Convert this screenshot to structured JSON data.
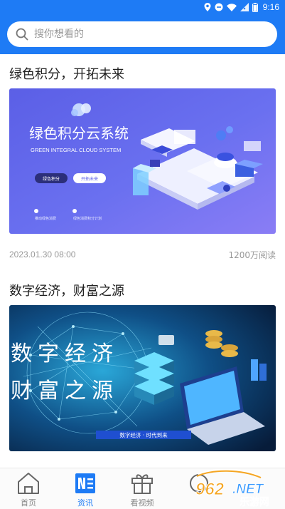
{
  "status_bar": {
    "time": "9:16"
  },
  "search": {
    "placeholder": "搜你想看的"
  },
  "articles": [
    {
      "title": "绿色积分，开拓未来",
      "banner": {
        "heading": "绿色积分云系统",
        "subheading": "GREEN INTEGRAL CLOUD SYSTEM",
        "button_primary": "绿色积分",
        "button_secondary": "开拓未来",
        "note_1": "推动绿色消费",
        "note_2": "绿色消费积分计划"
      },
      "date": "2023.01.30 08:00",
      "reads": "1200万阅读"
    },
    {
      "title": "数字经济，财富之源",
      "banner": {
        "line1": "数字经济",
        "line2": "财富之源",
        "footer": "数字经济 · 时代到来"
      }
    }
  ],
  "tabbar": {
    "items": [
      {
        "label": "首页",
        "icon": "home-icon",
        "active": false
      },
      {
        "label": "资讯",
        "icon": "news-icon",
        "active": true
      },
      {
        "label": "看视频",
        "icon": "gift-icon",
        "active": false
      }
    ]
  },
  "watermark": {
    "number": "962",
    "suffix": ".NET",
    "site": "乐游网"
  },
  "colors": {
    "brand": "#1e7bf5",
    "text": "#222222",
    "meta": "#999999",
    "inactive_tab": "#888888"
  }
}
